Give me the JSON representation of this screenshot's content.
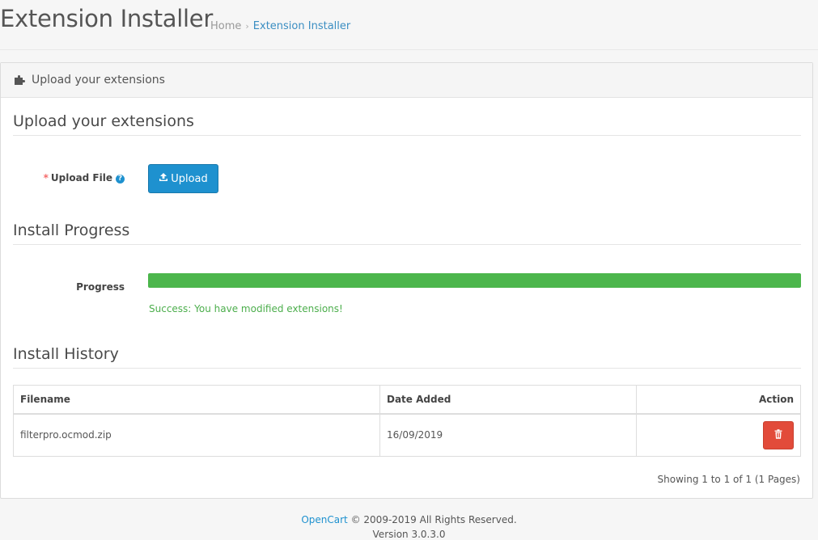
{
  "header": {
    "title": "Extension Installer",
    "breadcrumb": {
      "home": "Home",
      "separator": "›",
      "current": "Extension Installer"
    }
  },
  "panel": {
    "heading": "Upload your extensions",
    "heading_icon": "puzzle-icon",
    "upload_section": {
      "legend": "Upload your extensions",
      "label": "Upload File",
      "required_mark": "*",
      "help_mark": "?",
      "button_label": "Upload",
      "button_icon": "upload-icon"
    },
    "progress_section": {
      "legend": "Install Progress",
      "label": "Progress",
      "progress_fraction": 1.0,
      "status_text": "Success: You have modified extensions!"
    },
    "history_section": {
      "legend": "Install History",
      "columns": [
        "Filename",
        "Date Added",
        "Action"
      ],
      "rows": [
        {
          "filename": "filterpro.ocmod.zip",
          "date_added": "16/09/2019",
          "action_icon": "trash-icon"
        }
      ],
      "pagination": "Showing 1 to 1 of 1 (1 Pages)"
    }
  },
  "footer": {
    "brand": "OpenCart",
    "copyright": "© 2009-2019 All Rights Reserved.",
    "version": "Version 3.0.3.0"
  },
  "colors": {
    "primary": "#1e91cf",
    "success": "#4cb64c",
    "danger": "#e24b3a",
    "required": "#f56b6b"
  }
}
